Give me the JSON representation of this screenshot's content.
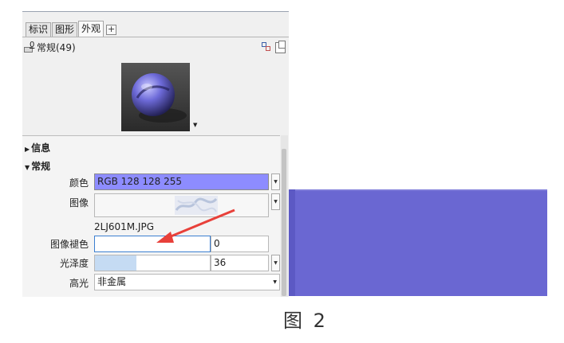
{
  "tabs": [
    {
      "label": "标识"
    },
    {
      "label": "图形"
    },
    {
      "label": "外观"
    }
  ],
  "tab_add_label": "+",
  "header": {
    "icon_number": "0",
    "title": "常规(49)"
  },
  "sections": {
    "info": {
      "arrow": "▶",
      "label": "信息"
    },
    "general": {
      "arrow": "▼",
      "label": "常规"
    }
  },
  "properties": {
    "color": {
      "label": "颜色",
      "value": "RGB 128 128 255",
      "swatch": "#8080ff"
    },
    "image": {
      "label": "图像",
      "filename": "2LJ601M.JPG"
    },
    "image_fade": {
      "label": "图像褪色",
      "value": "0"
    },
    "gloss": {
      "label": "光泽度",
      "value": "36",
      "level_percent": 36
    },
    "highlight": {
      "label": "高光",
      "value": "非金属"
    }
  },
  "caption": "图 2",
  "colors": {
    "accent_blue": "#6a67d2",
    "arrow_red": "#e8403a"
  }
}
